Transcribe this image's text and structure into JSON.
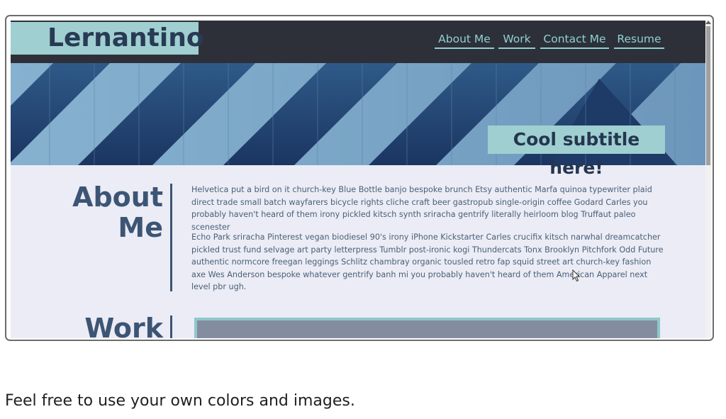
{
  "site": {
    "logo": "Lernantino",
    "nav": [
      "About Me",
      "Work",
      "Contact Me",
      "Resume"
    ],
    "hero_subtitle": "Cool subtitle here!"
  },
  "about": {
    "title_line1": "About",
    "title_line2": "Me",
    "paragraphs": [
      "Helvetica put a bird on it church-key Blue Bottle banjo bespoke brunch Etsy authentic Marfa quinoa typewriter plaid direct trade small batch wayfarers bicycle rights cliche craft beer gastropub single-origin coffee Godard Carles you probably haven't heard of them irony pickled kitsch synth sriracha gentrify literally heirloom blog Truffaut paleo scenester",
      "Echo Park sriracha Pinterest vegan biodiesel 90's irony iPhone Kickstarter Carles crucifix kitsch narwhal dreamcatcher pickled trust fund selvage art party letterpress Tumblr post-ironic kogi Thundercats Tonx Brooklyn Pitchfork Odd Future authentic normcore freegan leggings Schlitz chambray organic tousled retro fap squid street art church-key fashion axe Wes Anderson bespoke whatever gentrify banh mi you probably haven't heard of them American Apparel next level pbr ugh."
    ]
  },
  "work": {
    "title": "Work"
  },
  "caption": "Feel free to use your own colors and images.",
  "colors": {
    "nav_bg": "#2d3039",
    "accent": "#9fcfd0",
    "heading": "#3d5575",
    "page_bg": "#ebecf5"
  }
}
